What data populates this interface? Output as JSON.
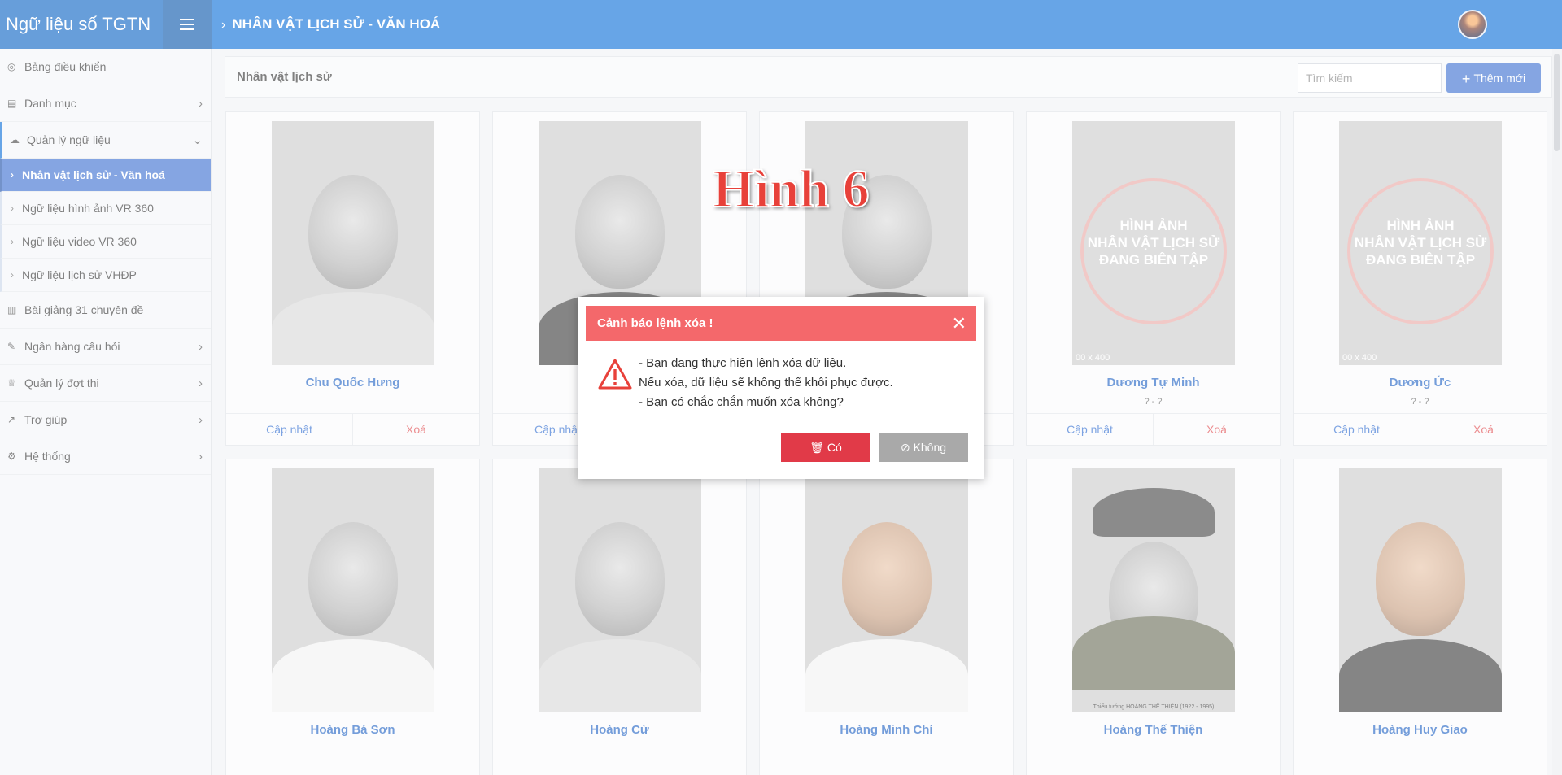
{
  "brand": "Ngữ liệu số TGTN",
  "breadcrumb": "NHÂN VẬT LỊCH SỬ - VĂN HOÁ",
  "sidebar": {
    "items": [
      {
        "label": "Bảng điều khiển"
      },
      {
        "label": "Danh mục"
      },
      {
        "label": "Quản lý ngữ liệu"
      },
      {
        "label": "Bài giảng 31 chuyên đề"
      },
      {
        "label": "Ngân hàng câu hỏi"
      },
      {
        "label": "Quản lý đợt thi"
      },
      {
        "label": "Trợ giúp"
      },
      {
        "label": "Hệ thống"
      }
    ],
    "subitems": [
      {
        "label": "Nhân vật lịch sử - Văn hoá"
      },
      {
        "label": "Ngữ liệu hình ảnh VR 360"
      },
      {
        "label": "Ngữ liệu video VR 360"
      },
      {
        "label": "Ngữ liệu lịch sử VHĐP"
      }
    ]
  },
  "content": {
    "title": "Nhân vật lịch sử",
    "search_placeholder": "Tìm kiếm",
    "add_label": "Thêm mới"
  },
  "card_actions": {
    "update": "Cập nhật",
    "delete": "Xoá",
    "update_partial": "Cập nhậ"
  },
  "cards_row1": [
    {
      "name": "Chu Quốc Hưng",
      "years": ""
    },
    {
      "name": "",
      "years": ""
    },
    {
      "name": "",
      "years": ""
    },
    {
      "name": "Dương Tự Minh",
      "years": "? - ?"
    },
    {
      "name": "Dương Ức",
      "years": "? - ?"
    }
  ],
  "cards_row2": [
    {
      "name": "Hoàng Bá Sơn"
    },
    {
      "name": "Hoàng Cừ"
    },
    {
      "name": "Hoàng Minh Chí"
    },
    {
      "name": "Hoàng Thế Thiện"
    },
    {
      "name": "Hoàng Huy Giao"
    }
  ],
  "placeholder_image": {
    "line1": "HÌNH ẢNH",
    "line2": "NHÂN VẬT LỊCH SỬ",
    "line3": "ĐANG BIÊN TẬP",
    "size": "00 x 400"
  },
  "photo_caption": "Thiếu tướng HOÀNG THẾ THIỆN (1922 - 1995)",
  "figure_label": "Hình 6",
  "modal": {
    "title": "Cảnh báo lệnh xóa !",
    "line1": "- Bạn đang thực hiện lệnh xóa dữ liệu.",
    "line2": "Nếu xóa, dữ liệu sẽ không thể khôi phục được.",
    "line3": "- Bạn có chắc chắn muốn xóa không?",
    "yes_label": "Có",
    "no_label": "Không"
  }
}
